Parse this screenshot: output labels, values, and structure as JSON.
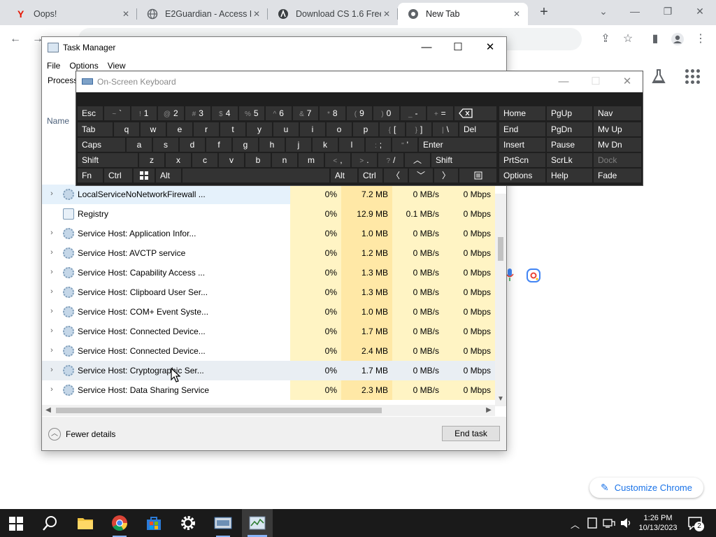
{
  "browser": {
    "tabs": [
      {
        "title": "Oops!",
        "icon": "yandex-icon"
      },
      {
        "title": "E2Guardian - Access De",
        "icon": "globe-icon"
      },
      {
        "title": "Download CS 1.6 Free",
        "icon": "cs-icon"
      },
      {
        "title": "New Tab",
        "icon": "chrome-icon"
      }
    ],
    "new_tab_symbol": "+",
    "customize_label": "Customize Chrome"
  },
  "task_manager": {
    "title": "Task Manager",
    "menus": [
      "File",
      "Options",
      "View"
    ],
    "processes_tab": "Process",
    "name_column": "Name",
    "rows": [
      {
        "name": "LocalServiceNoNetworkFirewall ...",
        "cpu": "0%",
        "memory": "7.2 MB",
        "disk": "0 MB/s",
        "network": "0 Mbps",
        "expandable": true,
        "icon": "gear-icon"
      },
      {
        "name": "Registry",
        "cpu": "0%",
        "memory": "12.9 MB",
        "disk": "0.1 MB/s",
        "network": "0 Mbps",
        "expandable": false,
        "icon": "registry-icon"
      },
      {
        "name": "Service Host: Application Infor...",
        "cpu": "0%",
        "memory": "1.0 MB",
        "disk": "0 MB/s",
        "network": "0 Mbps",
        "expandable": true,
        "icon": "gear-icon"
      },
      {
        "name": "Service Host: AVCTP service",
        "cpu": "0%",
        "memory": "1.2 MB",
        "disk": "0 MB/s",
        "network": "0 Mbps",
        "expandable": true,
        "icon": "gear-icon"
      },
      {
        "name": "Service Host: Capability Access ...",
        "cpu": "0%",
        "memory": "1.3 MB",
        "disk": "0 MB/s",
        "network": "0 Mbps",
        "expandable": true,
        "icon": "gear-icon"
      },
      {
        "name": "Service Host: Clipboard User Ser...",
        "cpu": "0%",
        "memory": "1.3 MB",
        "disk": "0 MB/s",
        "network": "0 Mbps",
        "expandable": true,
        "icon": "gear-icon"
      },
      {
        "name": "Service Host: COM+ Event Syste...",
        "cpu": "0%",
        "memory": "1.0 MB",
        "disk": "0 MB/s",
        "network": "0 Mbps",
        "expandable": true,
        "icon": "gear-icon"
      },
      {
        "name": "Service Host: Connected Device...",
        "cpu": "0%",
        "memory": "1.7 MB",
        "disk": "0 MB/s",
        "network": "0 Mbps",
        "expandable": true,
        "icon": "gear-icon"
      },
      {
        "name": "Service Host: Connected Device...",
        "cpu": "0%",
        "memory": "2.4 MB",
        "disk": "0 MB/s",
        "network": "0 Mbps",
        "expandable": true,
        "icon": "gear-icon"
      },
      {
        "name": "Service Host: Cryptographic Ser...",
        "cpu": "0%",
        "memory": "1.7 MB",
        "disk": "0 MB/s",
        "network": "0 Mbps",
        "expandable": true,
        "icon": "gear-icon"
      },
      {
        "name": "Service Host: Data Sharing Service",
        "cpu": "0%",
        "memory": "2.3 MB",
        "disk": "0 MB/s",
        "network": "0 Mbps",
        "expandable": true,
        "icon": "gear-icon"
      }
    ],
    "fewer_details": "Fewer details",
    "end_task": "End task"
  },
  "osk": {
    "title": "On-Screen Keyboard",
    "labels": {
      "esc": "Esc",
      "tab": "Tab",
      "caps": "Caps",
      "shift": "Shift",
      "fn": "Fn",
      "ctrl": "Ctrl",
      "alt": "Alt",
      "del": "Del",
      "enter": "Enter",
      "home": "Home",
      "pgup": "PgUp",
      "nav": "Nav",
      "end": "End",
      "pgdn": "PgDn",
      "mvup": "Mv Up",
      "insert": "Insert",
      "pause": "Pause",
      "mvdn": "Mv Dn",
      "prtscn": "PrtScn",
      "scrlk": "ScrLk",
      "dock": "Dock",
      "options": "Options",
      "help": "Help",
      "fade": "Fade"
    },
    "number_row": [
      {
        "shift": "~",
        "main": "`"
      },
      {
        "shift": "!",
        "main": "1"
      },
      {
        "shift": "@",
        "main": "2"
      },
      {
        "shift": "#",
        "main": "3"
      },
      {
        "shift": "$",
        "main": "4"
      },
      {
        "shift": "%",
        "main": "5"
      },
      {
        "shift": "^",
        "main": "6"
      },
      {
        "shift": "&",
        "main": "7"
      },
      {
        "shift": "*",
        "main": "8"
      },
      {
        "shift": "(",
        "main": "9"
      },
      {
        "shift": ")",
        "main": "0"
      },
      {
        "shift": "_",
        "main": "-"
      },
      {
        "shift": "+",
        "main": "="
      }
    ],
    "top_row": [
      "q",
      "w",
      "e",
      "r",
      "t",
      "y",
      "u",
      "i",
      "o",
      "p"
    ],
    "top_row_symbols": [
      {
        "shift": "{",
        "main": "["
      },
      {
        "shift": "}",
        "main": "]"
      },
      {
        "shift": "|",
        "main": "\\"
      }
    ],
    "home_row": [
      "a",
      "s",
      "d",
      "f",
      "g",
      "h",
      "j",
      "k",
      "l"
    ],
    "home_row_symbols": [
      {
        "shift": ":",
        "main": ";"
      },
      {
        "shift": "\"",
        "main": "'"
      }
    ],
    "bottom_row": [
      "z",
      "x",
      "c",
      "v",
      "b",
      "n",
      "m"
    ],
    "bottom_row_symbols": [
      {
        "shift": "<",
        "main": ","
      },
      {
        "shift": ">",
        "main": "."
      },
      {
        "shift": "?",
        "main": "/"
      }
    ]
  },
  "taskbar": {
    "time": "1:26 PM",
    "date": "10/13/2023",
    "notification_count": "2"
  }
}
